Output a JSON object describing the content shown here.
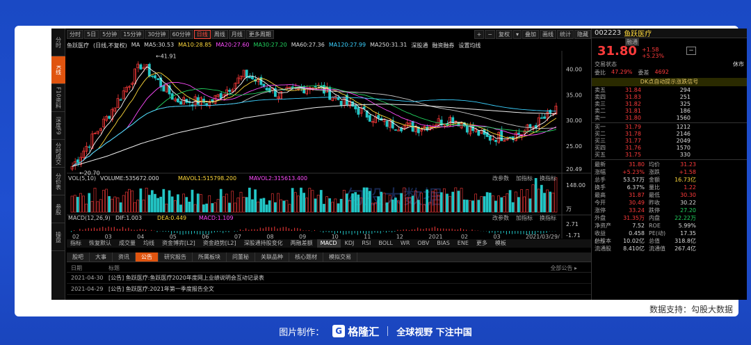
{
  "colors": {
    "up": "#ff3b3b",
    "down": "#22d35f",
    "ma5": "#ffffff",
    "ma10": "#ffd93b",
    "ma20": "#ff4bff",
    "ma30": "#22d35f",
    "ma60": "#c8c8c8",
    "ma120": "#3bd1ff",
    "ma250": "#ffffff"
  },
  "vtabs": [
    "分时",
    "K线",
    "F10资料",
    "深度F9",
    "分时成交",
    "分价表",
    "参股",
    "操盘"
  ],
  "toolbar": {
    "items": [
      "分时",
      "5日",
      "5分钟",
      "15分钟",
      "30分钟",
      "60分钟",
      "日线",
      "周线",
      "月线",
      "更多周期"
    ],
    "active_index": 6,
    "right": [
      "+",
      "−",
      "复权",
      "▾",
      "叠加",
      "画线",
      "统计",
      "隐藏"
    ]
  },
  "mainInfo": {
    "name": "鱼跃医疗",
    "mode": "(日线,不复权)",
    "ma_label": "MA",
    "ma5": "MA5:30.53",
    "ma10": "MA10:28.85",
    "ma20": "MA20:27.60",
    "ma30": "MA30:27.20",
    "ma60": "MA60:27.36",
    "ma120": "MA120:27.99",
    "ma250": "MA250:31.31",
    "extra1": "深股通",
    "extra2": "融资融券",
    "extra3": "设置均线"
  },
  "candle_annot": {
    "high": "41.91",
    "low": "20.70"
  },
  "price_axis": [
    "40.00",
    "35.00",
    "30.00",
    "25.00",
    "20.49"
  ],
  "vol_axis": [
    "148.00",
    "万"
  ],
  "macd_axis": [
    "2.71",
    "-1.71"
  ],
  "time_axis": [
    "02",
    "03",
    "04",
    "05",
    "06",
    "07",
    "08",
    "09",
    "10",
    "11",
    "12",
    "2021",
    "02",
    "03",
    "2021/03/29/"
  ],
  "volInfo": {
    "label": "VOL(5,10)",
    "volume": "VOLUME:535672.000",
    "mavol1": "MAVOL1:515798.200",
    "mavol2": "MAVOL2:315613.400"
  },
  "macdInfo": {
    "label": "MACD(12,26,9)",
    "dif": "DIF:1.003",
    "dea": "DEA:0.449",
    "macd": "MACD:1.109"
  },
  "chart_tools": [
    "改参数",
    "加指标",
    "换指标"
  ],
  "watermark": "勾股大数据",
  "indicator_tabs": [
    "指标",
    "恢复默认",
    "成交量",
    "均线",
    "资金博弈[L2]",
    "资金趋势[L2]",
    "深股通持股变化",
    "两融差额",
    "MACD",
    "KDJ",
    "RSI",
    "BOLL",
    "WR",
    "OBV",
    "BIAS",
    "ENE",
    "更多",
    "模板"
  ],
  "indicator_active": "MACD",
  "bottom_tabs": [
    "股吧",
    "大事",
    "资讯",
    "公告",
    "研究报告",
    "所属板块",
    "问董秘",
    "关联品种",
    "核心题材",
    "模拟交易"
  ],
  "bottom_active": "公告",
  "news_header": {
    "date": "日期",
    "title": "标题",
    "all": "全部公告 ▸"
  },
  "news": [
    {
      "date": "2021-04-30",
      "title": "[公告] 鱼跃医疗:鱼跃医疗2020年度网上业绩说明会互动记录表"
    },
    {
      "date": "2021-04-29",
      "title": "[公告] 鱼跃医疗:2021年第一季度报告全文"
    }
  ],
  "quote": {
    "code": "002223",
    "name": "鱼跃医疗",
    "tag": "融通",
    "price": "31.80",
    "chg": "+1.58",
    "pct": "+5.23%",
    "status_label": "交易状态",
    "status_value": "休市",
    "wb_label": "委比",
    "wb": "47.29%",
    "wc_label": "委差",
    "wc": "4692",
    "banner": "DK点自动提示涨跌信号"
  },
  "asks": [
    {
      "l": "卖五",
      "p": "31.84",
      "v": "294"
    },
    {
      "l": "卖四",
      "p": "31.83",
      "v": "251"
    },
    {
      "l": "卖三",
      "p": "31.82",
      "v": "325"
    },
    {
      "l": "卖二",
      "p": "31.81",
      "v": "186"
    },
    {
      "l": "卖一",
      "p": "31.80",
      "v": "1560"
    }
  ],
  "bids": [
    {
      "l": "买一",
      "p": "31.79",
      "v": "1212"
    },
    {
      "l": "买二",
      "p": "31.78",
      "v": "2146"
    },
    {
      "l": "买三",
      "p": "31.77",
      "v": "2049"
    },
    {
      "l": "买四",
      "p": "31.76",
      "v": "1570"
    },
    {
      "l": "买五",
      "p": "31.75",
      "v": "330"
    }
  ],
  "stats": [
    {
      "k": "最新",
      "v": "31.80",
      "c": "red",
      "k2": "均价",
      "v2": "31.23",
      "c2": "red"
    },
    {
      "k": "涨幅",
      "v": "+5.23%",
      "c": "red",
      "k2": "涨跌",
      "v2": "+1.58",
      "c2": "red"
    },
    {
      "k": "总手",
      "v": "53.57万",
      "c": "white",
      "k2": "金额",
      "v2": "16.73亿",
      "c2": "yellow"
    },
    {
      "k": "换手",
      "v": "6.37%",
      "c": "white",
      "k2": "量比",
      "v2": "1.22",
      "c2": "red"
    },
    {
      "k": "最高",
      "v": "31.87",
      "c": "red",
      "k2": "最低",
      "v2": "30.30",
      "c2": "red"
    },
    {
      "k": "今开",
      "v": "30.49",
      "c": "red",
      "k2": "昨收",
      "v2": "30.22",
      "c2": "white"
    },
    {
      "k": "涨停",
      "v": "33.24",
      "c": "red",
      "k2": "跌停",
      "v2": "27.20",
      "c2": "green"
    },
    {
      "k": "外盘",
      "v": "31.35万",
      "c": "red",
      "k2": "内盘",
      "v2": "22.22万",
      "c2": "green"
    },
    {
      "k": "净资产",
      "v": "7.52",
      "c": "white",
      "k2": "ROE",
      "v2": "5.99%",
      "c2": "white"
    },
    {
      "k": "收益(一)",
      "v": "0.458",
      "c": "white",
      "k2": "PE(动)",
      "v2": "17.35",
      "c2": "white"
    },
    {
      "k": "总股本",
      "v": "10.02亿",
      "c": "white",
      "k2": "总值",
      "v2": "318.8亿",
      "c2": "white"
    },
    {
      "k": "流通股",
      "v": "8.410亿",
      "c": "white",
      "k2": "流通值",
      "v2": "267.4亿",
      "c2": "white"
    }
  ],
  "credit": "数据支持：勾股大数据",
  "footer": {
    "made_by": "图片制作：",
    "brand": "格隆汇",
    "slogan": "全球视野 下注中国"
  },
  "chart_data": {
    "type": "candlestick",
    "title": "鱼跃医疗 (日线,不复权)",
    "xlabel": "",
    "ylabel": "",
    "ylim": [
      20.49,
      42.0
    ],
    "x": [
      "02",
      "03",
      "04",
      "05",
      "06",
      "07",
      "08",
      "09",
      "10",
      "11",
      "12",
      "2021",
      "02",
      "03"
    ],
    "series": [
      {
        "name": "close",
        "values": [
          21.0,
          30.5,
          41.0,
          34.0,
          33.5,
          39.0,
          35.0,
          37.0,
          33.0,
          29.5,
          28.5,
          30.5,
          26.5,
          27.5,
          31.8
        ]
      },
      {
        "name": "MA250",
        "values": [
          21.0,
          23.0,
          25.5,
          27.5,
          29.0,
          30.5,
          31.5,
          32.5,
          33.0,
          33.2,
          33.0,
          32.5,
          32.0,
          31.5,
          31.31
        ]
      },
      {
        "name": "MA60",
        "values": [
          24.0,
          28.0,
          34.0,
          35.0,
          34.0,
          35.0,
          37.0,
          36.0,
          34.0,
          31.0,
          30.0,
          29.0,
          28.0,
          27.2,
          27.36
        ]
      }
    ],
    "annotations": [
      "41.91",
      "20.70"
    ]
  }
}
